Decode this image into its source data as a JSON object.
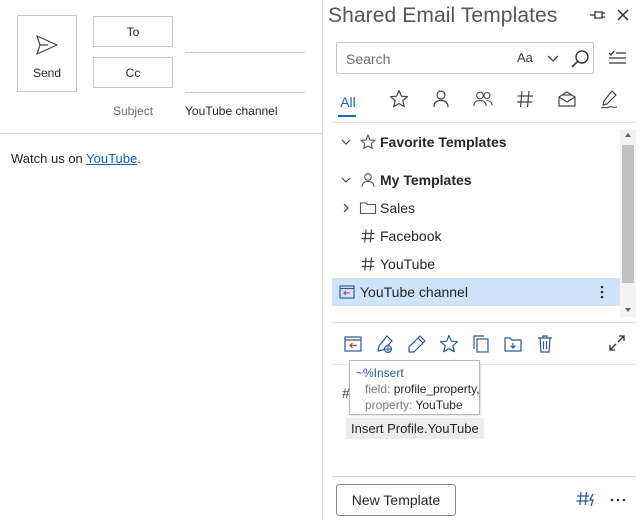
{
  "compose": {
    "send_label": "Send",
    "to_label": "To",
    "cc_label": "Cc",
    "subject_label": "Subject",
    "subject_value": "YouTube channel",
    "body_prefix": "Watch us on ",
    "body_link": "YouTube",
    "body_suffix": "."
  },
  "pane": {
    "title": "Shared Email Templates",
    "search_placeholder": "Search",
    "match_case_label": "Aa",
    "tabs": {
      "all": "All",
      "icons": [
        "star-icon",
        "person-icon",
        "people-icon",
        "hash-icon",
        "inbox-icon",
        "signature-icon"
      ]
    },
    "tree": [
      {
        "label": "Favorite Templates",
        "kind": "section"
      },
      {
        "label": "My Templates",
        "kind": "section"
      },
      {
        "label": "Sales",
        "kind": "folder"
      },
      {
        "label": "Facebook",
        "kind": "macro"
      },
      {
        "label": "YouTube",
        "kind": "macro"
      },
      {
        "label": "YouTube channel",
        "kind": "template",
        "selected": true
      }
    ],
    "toolbar_icons": [
      "insert-template-icon",
      "insert-link-icon",
      "edit-icon",
      "favorite-icon",
      "copy-icon",
      "move-icon",
      "delete-icon"
    ],
    "preview": {
      "hash_peek": "#",
      "tooltip_title": "~%Insert",
      "tooltip_field_key": "field:",
      "tooltip_field_val": "profile_property,",
      "tooltip_property_key": "property:",
      "tooltip_property_val": "YouTube",
      "macro_label": "Insert Profile.YouTube"
    },
    "new_template_label": "New Template"
  },
  "colors": {
    "accent": "#0f6cbd",
    "selection": "#cfe4fa",
    "link": "#0f5fb5"
  }
}
